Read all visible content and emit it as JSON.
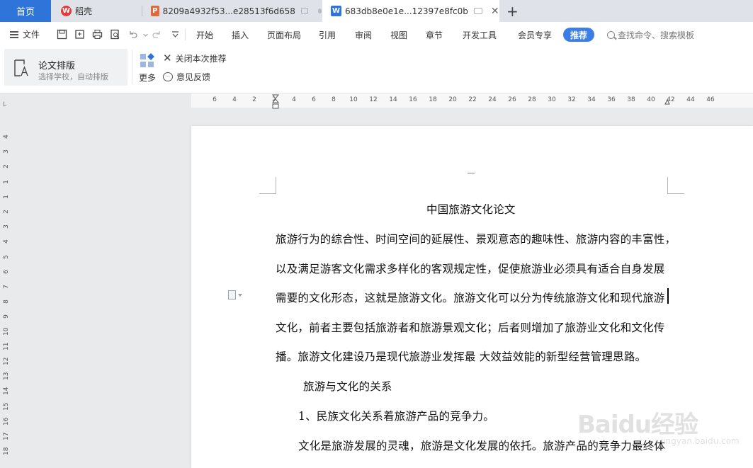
{
  "tabs": {
    "home": "首页",
    "daoke": "稻壳",
    "doc1": "8209a4932f53...e28513f6d658",
    "doc2": "683db8e0e1e...12397e8fc0b",
    "add": "+",
    "close": "✕"
  },
  "menubar": {
    "file": "文件",
    "items": [
      "开始",
      "插入",
      "页面布局",
      "引用",
      "审阅",
      "视图",
      "章节",
      "开发工具",
      "会员专享"
    ],
    "recommend": "推荐",
    "search_placeholder": "查找命令、搜索模板"
  },
  "ribbon": {
    "card_title": "论文排版",
    "card_sub": "选择学校，自动排版",
    "more": "更多",
    "close_recommend": "关闭本次推荐",
    "feedback": "意见反馈"
  },
  "ruler": {
    "corner": "L",
    "h_ticks": [
      "6",
      "4",
      "2",
      "2",
      "4",
      "6",
      "8",
      "10",
      "12",
      "14",
      "16",
      "18",
      "20",
      "22",
      "24",
      "26",
      "28",
      "30",
      "32",
      "34",
      "36",
      "38",
      "40",
      "42",
      "44",
      "46"
    ],
    "v_ticks": [
      "4",
      "3",
      "2",
      "1",
      "1",
      "2",
      "3",
      "4",
      "5",
      "6",
      "7",
      "8",
      "9",
      "10",
      "11",
      "12",
      "13",
      "14",
      "15",
      "16",
      "17",
      "18"
    ]
  },
  "document": {
    "header_mark": "—",
    "title": "中国旅游文化论文",
    "lines": [
      "旅游行为的综合性、时间空间的延展性、景观意态的趣味性、旅游内容的丰富性，",
      "以及满足游客文化需求多样化的客观规定性，促使旅游业必须具有适合自身发展",
      "需要的文化形态，这就是旅游文化。旅游文化可以分为传统旅游文化和现代旅游",
      "文化，前者主要包括旅游者和旅游景观文化；后者则增加了旅游业文化和文化传",
      "播。旅游文化建设乃是现代旅游业发挥最 大效益效能的新型经营管理思路。",
      "旅游与文化的关系",
      "1、民族文化关系着旅游产品的竞争力。",
      "文化是旅游发展的灵魂，旅游是文化发展的依托。旅游产品的竞争力最终体"
    ]
  },
  "watermark": {
    "text": "Baidu经验",
    "sub": "jingyan.baidu.com"
  },
  "colors": {
    "accent": "#2f74d8",
    "recommend_bg": "#3a7ee6",
    "tabbar_bg": "#dfe2e8",
    "canvas_bg": "#e9eaec"
  }
}
